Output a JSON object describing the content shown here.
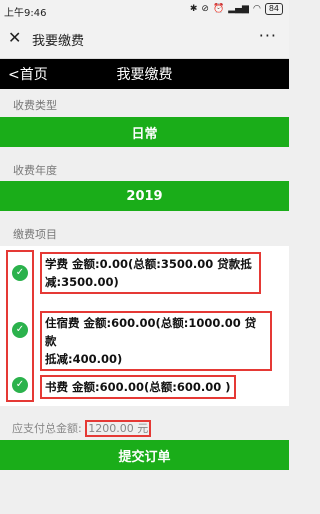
{
  "status_bar": {
    "time": "上午9:46",
    "battery": "84"
  },
  "wechat_bar": {
    "title": "我要缴费"
  },
  "nav": {
    "back": "<首页",
    "title": "我要缴费"
  },
  "fee_type": {
    "label": "收费类型",
    "value": "日常"
  },
  "fee_year": {
    "label": "收费年度",
    "value": "2019"
  },
  "fee_items": {
    "label": "缴费项目",
    "items": [
      {
        "line1": "学费 金额:0.00(总额:3500.00 贷款抵",
        "line2": "减:3500.00)"
      },
      {
        "line1": "住宿费 金额:600.00(总额:1000.00 贷款",
        "line2": "抵减:400.00)"
      },
      {
        "line1": "书费 金额:600.00(总额:600.00 )"
      }
    ]
  },
  "total": {
    "label": "应支付总金额:",
    "amount": "1200.00 元"
  },
  "submit": {
    "label": "提交订单"
  },
  "colors": {
    "accent": "#1aad19",
    "highlight": "#e53935",
    "check": "#2bb24c"
  }
}
